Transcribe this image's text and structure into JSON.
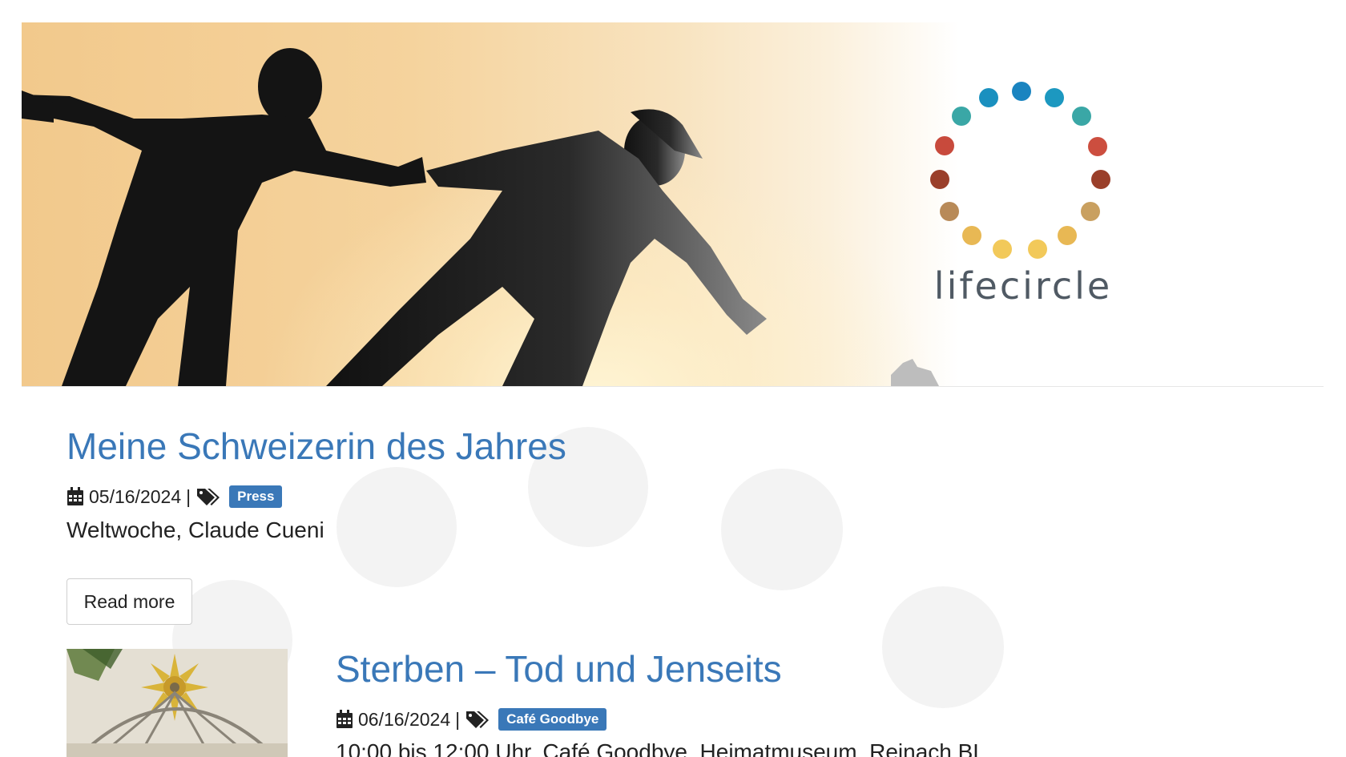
{
  "banner": {
    "logo_text": "lifecircle",
    "logo_colors": [
      "#1a84c0",
      "#1c98c0",
      "#3aa7a6",
      "#cc4e3f",
      "#9a3f2a",
      "#b88a58",
      "#e8b854",
      "#f2c95a"
    ]
  },
  "posts": [
    {
      "title": "Meine Schweizerin des Jahres",
      "date": "05/16/2024",
      "separator": "|",
      "tag": "Press",
      "subtitle": "Weltwoche, Claude Cueni",
      "read_more": "Read more"
    },
    {
      "title": "Sterben – Tod und Jenseits",
      "date": "06/16/2024",
      "separator": "|",
      "tag": "Café Goodbye",
      "subtitle": "10:00 bis 12:00 Uhr, Café Goodbye, Heimatmuseum, Reinach BL"
    }
  ],
  "colors": {
    "link_blue": "#3a78b8",
    "badge_blue": "#3a78b8"
  },
  "icons": {
    "date": "calendar-icon",
    "tags": "tags-icon"
  }
}
